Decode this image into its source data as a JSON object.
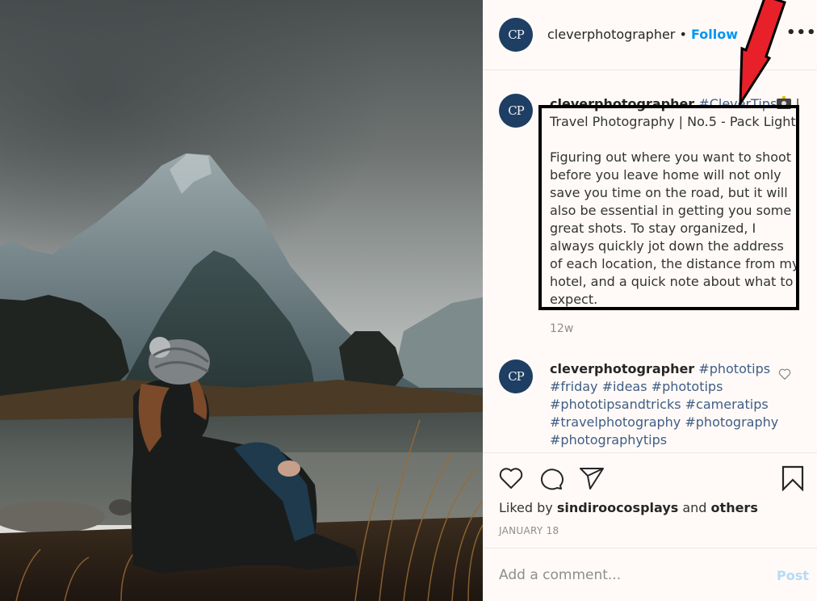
{
  "post": {
    "author": "cleverphotographer",
    "avatar_initials": "CP",
    "separator_dot": "•",
    "follow_label": "Follow",
    "more_icon": "more-horizontal-icon",
    "more_glyph": "•••"
  },
  "caption": {
    "author": "cleverphotographer",
    "hashtag": "#CleverTips",
    "emoji_icon": "camera-icon",
    "after_emoji": " |",
    "line2": "Travel Photography | No.5 - Pack Light",
    "body": "Figuring out where you want to shoot before you leave home will not only save you time on the road, but it will also be essential in getting you some great shots. To stay organized, I always quickly jot down the address of each location, the distance from my hotel, and a quick note about what to expect.",
    "age": "12w"
  },
  "comment": {
    "author": "cleverphotographer",
    "tags": "#phototips #friday #ideas #phototips #phototipsandtricks #cameratips #travelphotography #photography #photographytips"
  },
  "actions": {
    "like_icon": "heart-icon",
    "comment_icon": "comment-icon",
    "share_icon": "send-icon",
    "save_icon": "bookmark-icon"
  },
  "likes": {
    "prefix": "Liked by ",
    "user": "sindiroocosplays",
    "middle": " and ",
    "others": "others"
  },
  "date": "JANUARY 18",
  "add_comment": {
    "placeholder": "Add a comment...",
    "value": "",
    "post_label": "Post"
  },
  "annotation": {
    "arrow_color": "#e8202a",
    "box_color": "#000000"
  },
  "colors": {
    "follow": "#0095f6",
    "hashtag": "#3f5d85",
    "avatar_bg": "#1e3e63",
    "post_disabled": "#b3dbf8"
  }
}
